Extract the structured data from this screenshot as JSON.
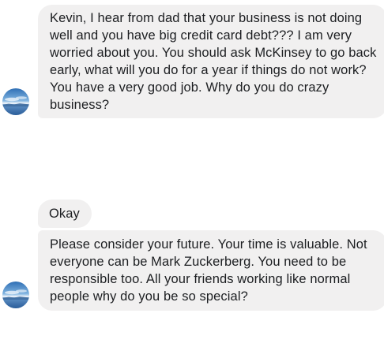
{
  "conversation": {
    "messages": [
      {
        "sender": "other",
        "text": "Kevin, I hear from dad that your business is not doing well and you have big credit card debt??? I am very worried about you. You should ask McKinsey to go back early, what will you do for a year if things do not work? You have a very good job. Why do you do crazy business?"
      },
      {
        "sender": "other",
        "text": "Okay"
      },
      {
        "sender": "other",
        "text": "Please consider your future. Your time is valuable. Not everyone can be Mark Zuckerberg. You need to be responsible too. All your friends working like normal people why do you be so special?"
      }
    ],
    "colors": {
      "bubble": "#f1f0f0",
      "text": "#1c1e21",
      "background": "#ffffff"
    },
    "avatar_icon": "landscape-photo-avatar"
  }
}
